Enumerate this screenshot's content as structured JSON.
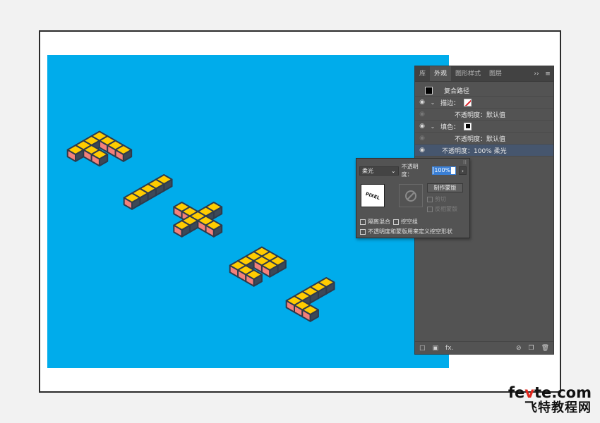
{
  "panel": {
    "tabs": [
      "库",
      "外观",
      "图形样式",
      "图层"
    ],
    "active_tab": 1,
    "more_icon": "double-chevron-right-icon",
    "menu_icon": "hamburger-icon",
    "title_row": "复合路径",
    "stroke_label": "描边：",
    "stroke_opacity": "不透明度：默认值",
    "fill_label": "填色：",
    "fill_opacity": "不透明度：默认值",
    "object_opacity": "不透明度：100% 柔光",
    "footer_fx": "fx."
  },
  "popup": {
    "blend_mode": "柔光",
    "opacity_label": "不透明度：",
    "opacity_value": "100%",
    "thumb_text": "PIXEL",
    "make_mask_button": "制作蒙版",
    "clip_label": "剪切",
    "invert_mask_label": "反相蒙版",
    "isolate_label": "隔离混合",
    "knockout_label": "挖空组",
    "opacity_mask_label": "不透明度和蒙版用来定义挖空形状"
  },
  "colors": {
    "artboard": "#00aceb",
    "letter_top": "#ffcc00",
    "letter_side": "#f4807a",
    "letter_outline": "#2f3a4b",
    "selection": "#7a6cff"
  },
  "watermark": {
    "line1_a": "fe",
    "line1_b": "v",
    "line1_c": "te.com",
    "line2": "飞特教程网"
  }
}
